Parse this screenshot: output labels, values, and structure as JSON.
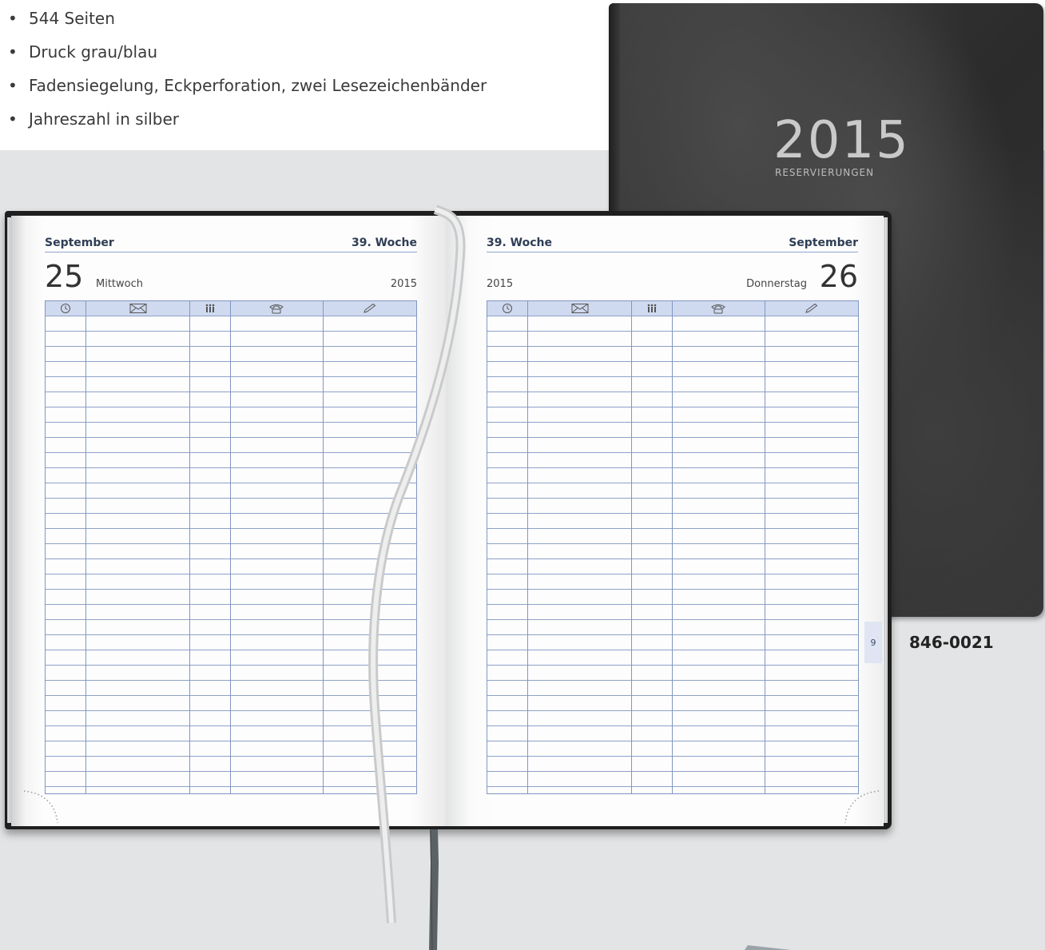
{
  "features": [
    {
      "text": "544 Seiten"
    },
    {
      "text": "Druck grau/blau"
    },
    {
      "text": "Fadensiegelung, Eckperforation, zwei Lesezeichenbänder"
    },
    {
      "text": "Jahreszahl in silber"
    }
  ],
  "cover": {
    "year": "2015",
    "subtitle": "RESERVIERUNGEN"
  },
  "article_number": "846-0021",
  "left_page": {
    "month": "September",
    "week": "39. Woche",
    "day_number": "25",
    "day_name": "Mittwoch",
    "year": "2015"
  },
  "right_page": {
    "month": "September",
    "week": "39. Woche",
    "day_number": "26",
    "day_name": "Donnerstag",
    "year": "2015"
  },
  "table_icons": [
    "clock-icon",
    "envelope-icon",
    "people-icon",
    "telephone-icon",
    "pencil-icon"
  ],
  "register_tab": "9",
  "colors": {
    "grid_line": "#8296c3",
    "grid_header": "#cfdaf0",
    "header_text": "#2f3d55",
    "cover": "#333333",
    "background": "#e3e4e5"
  }
}
